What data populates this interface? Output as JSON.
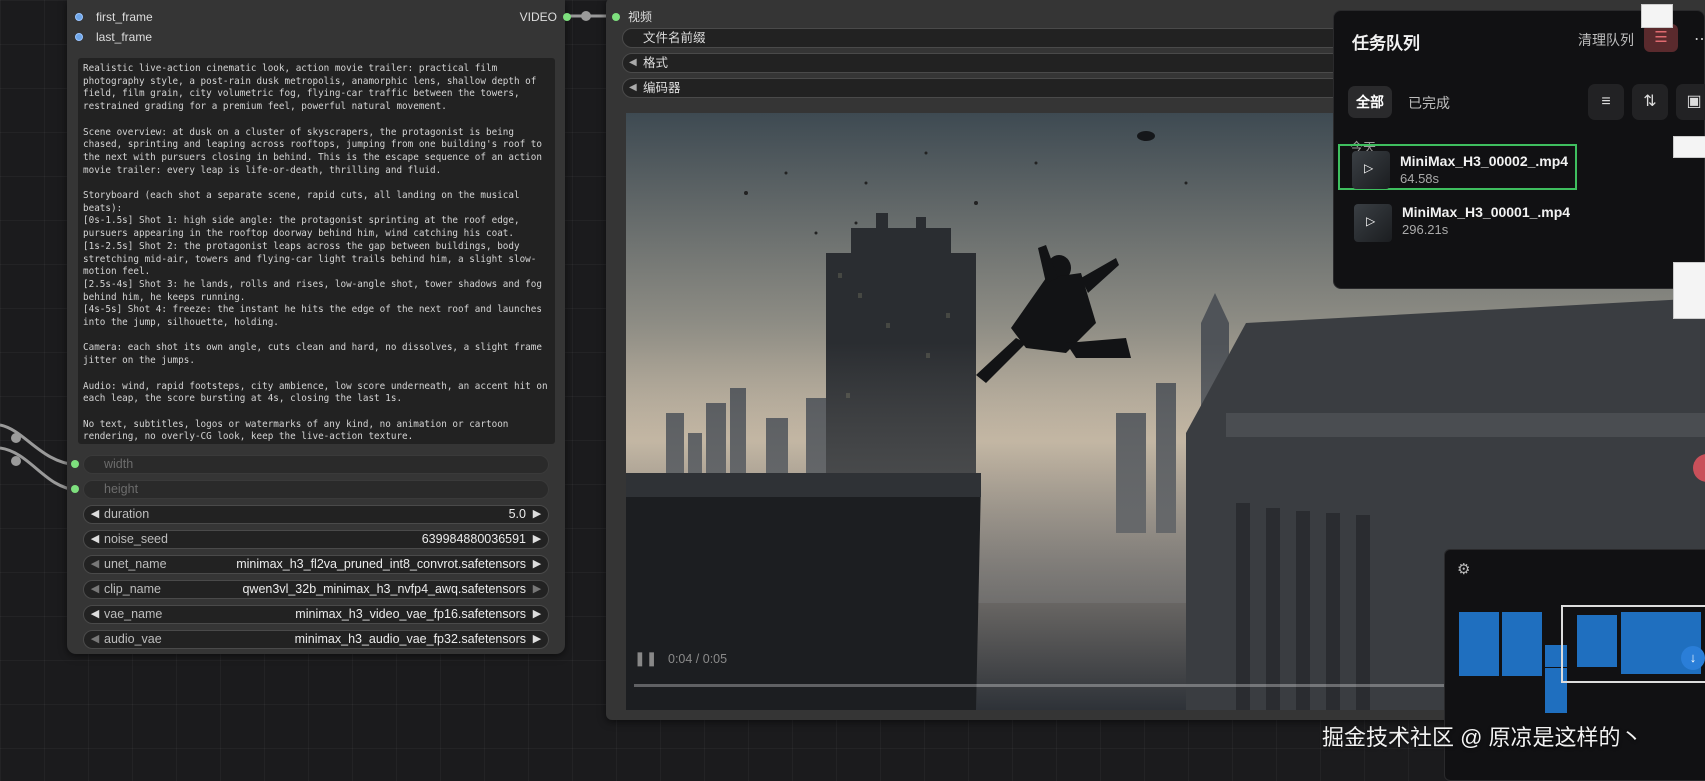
{
  "left_node": {
    "inputs": [
      {
        "label": "first_frame"
      },
      {
        "label": "last_frame"
      }
    ],
    "output_label": "VIDEO",
    "prompt_paragraphs": [
      "Realistic live-action cinematic look, action movie trailer: practical film photography style, a post-rain dusk metropolis, anamorphic lens, shallow depth of field, film grain, city volumetric fog, flying-car traffic between the towers, restrained grading for a premium feel, powerful natural movement.",
      "Scene overview: at dusk on a cluster of skyscrapers, the protagonist is being chased, sprinting and leaping across rooftops, jumping from one building's roof to the next with pursuers closing in behind. This is the escape sequence of an action movie trailer: every leap is life-or-death, thrilling and fluid.",
      "Storyboard (each shot a separate scene, rapid cuts, all landing on the musical beats):\n[0s-1.5s] Shot 1: high side angle: the protagonist sprinting at the roof edge, pursuers appearing in the rooftop doorway behind him, wind catching his coat.\n[1s-2.5s] Shot 2: the protagonist leaps across the gap between buildings, body stretching mid-air, towers and flying-car light trails behind him, a slight slow-motion feel.\n[2.5s-4s] Shot 3: he lands, rolls and rises, low-angle shot, tower shadows and fog behind him, he keeps running.\n[4s-5s] Shot 4: freeze: the instant he hits the edge of the next roof and launches into the jump, silhouette, holding.",
      "Camera: each shot its own angle, cuts clean and hard, no dissolves, a slight frame jitter on the jumps.",
      "Audio: wind, rapid footsteps, city ambience, low score underneath, an accent hit on each leap, the score bursting at 4s, closing the last 1s.",
      "No text, subtitles, logos or watermarks of any kind, no animation or cartoon rendering, no overly-CG look, keep the live-action texture."
    ],
    "width_label": "width",
    "height_label": "height",
    "widgets": [
      {
        "name": "duration",
        "value": "5.0"
      },
      {
        "name": "noise_seed",
        "value": "639984880036591"
      },
      {
        "name": "unet_name",
        "value": "minimax_h3_fl2va_pruned_int8_convrot.safetensors"
      },
      {
        "name": "clip_name",
        "value": "qwen3vl_32b_minimax_h3_nvfp4_awq.safetensors"
      },
      {
        "name": "vae_name",
        "value": "minimax_h3_video_vae_fp16.safetensors"
      },
      {
        "name": "audio_vae",
        "value": "minimax_h3_audio_vae_fp32.safetensors"
      }
    ]
  },
  "right_node": {
    "input_label": "视频",
    "combos": [
      "文件名前缀",
      "格式",
      "编码器"
    ],
    "video_time": "0:04 / 0:05"
  },
  "queue": {
    "title": "任务队列",
    "clear_label": "清理队列",
    "tab_all": "全部",
    "tab_done": "已完成",
    "date_group": "今天",
    "items": [
      {
        "name": "MiniMax_H3_00002_.mp4",
        "duration": "64.58s",
        "selected": true
      },
      {
        "name": "MiniMax_H3_00001_.mp4",
        "duration": "296.21s",
        "selected": false
      }
    ]
  },
  "watermark": "掘金技术社区 @ 原凉是这样的丶",
  "colors": {
    "node_bg": "#353535",
    "canvas_bg": "#1b1b1d",
    "selection": "#3fbf5f",
    "clear_btn": "#5a2a2d",
    "minimap_block": "#1f6fbf"
  }
}
